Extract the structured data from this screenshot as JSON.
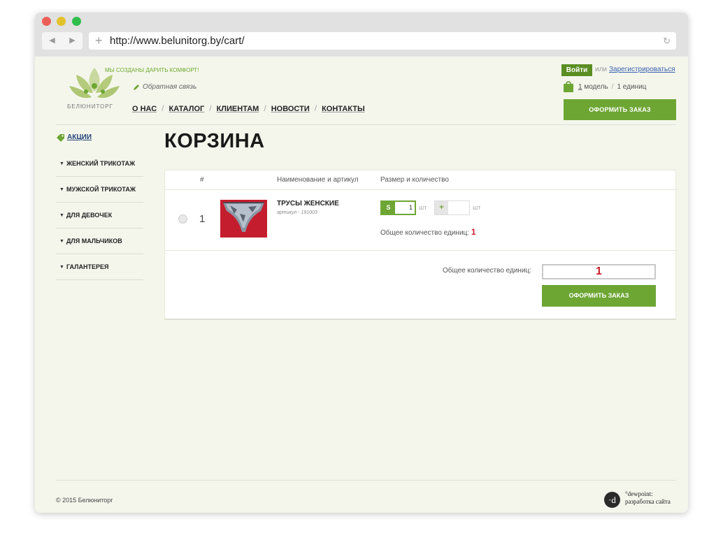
{
  "browser": {
    "url": "http://www.belunitorg.by/cart/",
    "back_glyph": "◀",
    "forward_glyph": "▶",
    "new_tab_glyph": "+",
    "reload_glyph": "↻"
  },
  "header": {
    "slogan": "МЫ СОЗДАНЫ ДАРИТЬ КОМФОРТ!",
    "logo_word": "БЕЛЮНИТОРГ",
    "feedback": "Обратная связь",
    "nav": [
      "О НАС",
      "КАТАЛОГ",
      "КЛИЕНТАМ",
      "НОВОСТИ",
      "КОНТАКТЫ"
    ],
    "nav_separator": "/",
    "login": "Войти",
    "or": "или",
    "register": "Зарегистрироваться",
    "cart_models_count": "1",
    "cart_models_label": "модель",
    "cart_units": "1 единиц",
    "cart_separator": "/",
    "order_button": "ОФОРМИТЬ ЗАКАЗ"
  },
  "sidebar": {
    "promo": "АКЦИИ",
    "items": [
      "ЖЕНСКИЙ ТРИКОТАЖ",
      "МУЖСКОЙ ТРИКОТАЖ",
      "ДЛЯ ДЕВОЧЕК",
      "ДЛЯ МАЛЬЧИКОВ",
      "ГАЛАНТЕРЕЯ"
    ],
    "bullet": "▼"
  },
  "cart": {
    "title": "КОРЗИНА",
    "columns": {
      "num": "#",
      "name": "Наименование и артикул",
      "size": "Размер и количество"
    },
    "items": [
      {
        "num": "1",
        "name": "ТРУСЫ ЖЕНСКИЕ",
        "article": "артикул - 191003",
        "size_label": "S",
        "size_qty": "1",
        "unit": "шт",
        "add_label": "+",
        "add_unit": "шт",
        "total_label": "Общее количество единиц:",
        "total_value": "1"
      }
    ],
    "grand_total_label": "Общее количество единиц:",
    "grand_total_value": "1",
    "order_button": "ОФОРМИТЬ ЗАКАЗ"
  },
  "footer": {
    "copyright": "© 2015 Белюниторг",
    "dev_logo": "·d",
    "dev_name": "°dewpoint:",
    "dev_tagline": "разработка сайта"
  },
  "colors": {
    "accent": "#6ea634",
    "dark_green": "#5a8e22",
    "price_red": "#c8202d",
    "link_blue": "#3a62b0"
  }
}
